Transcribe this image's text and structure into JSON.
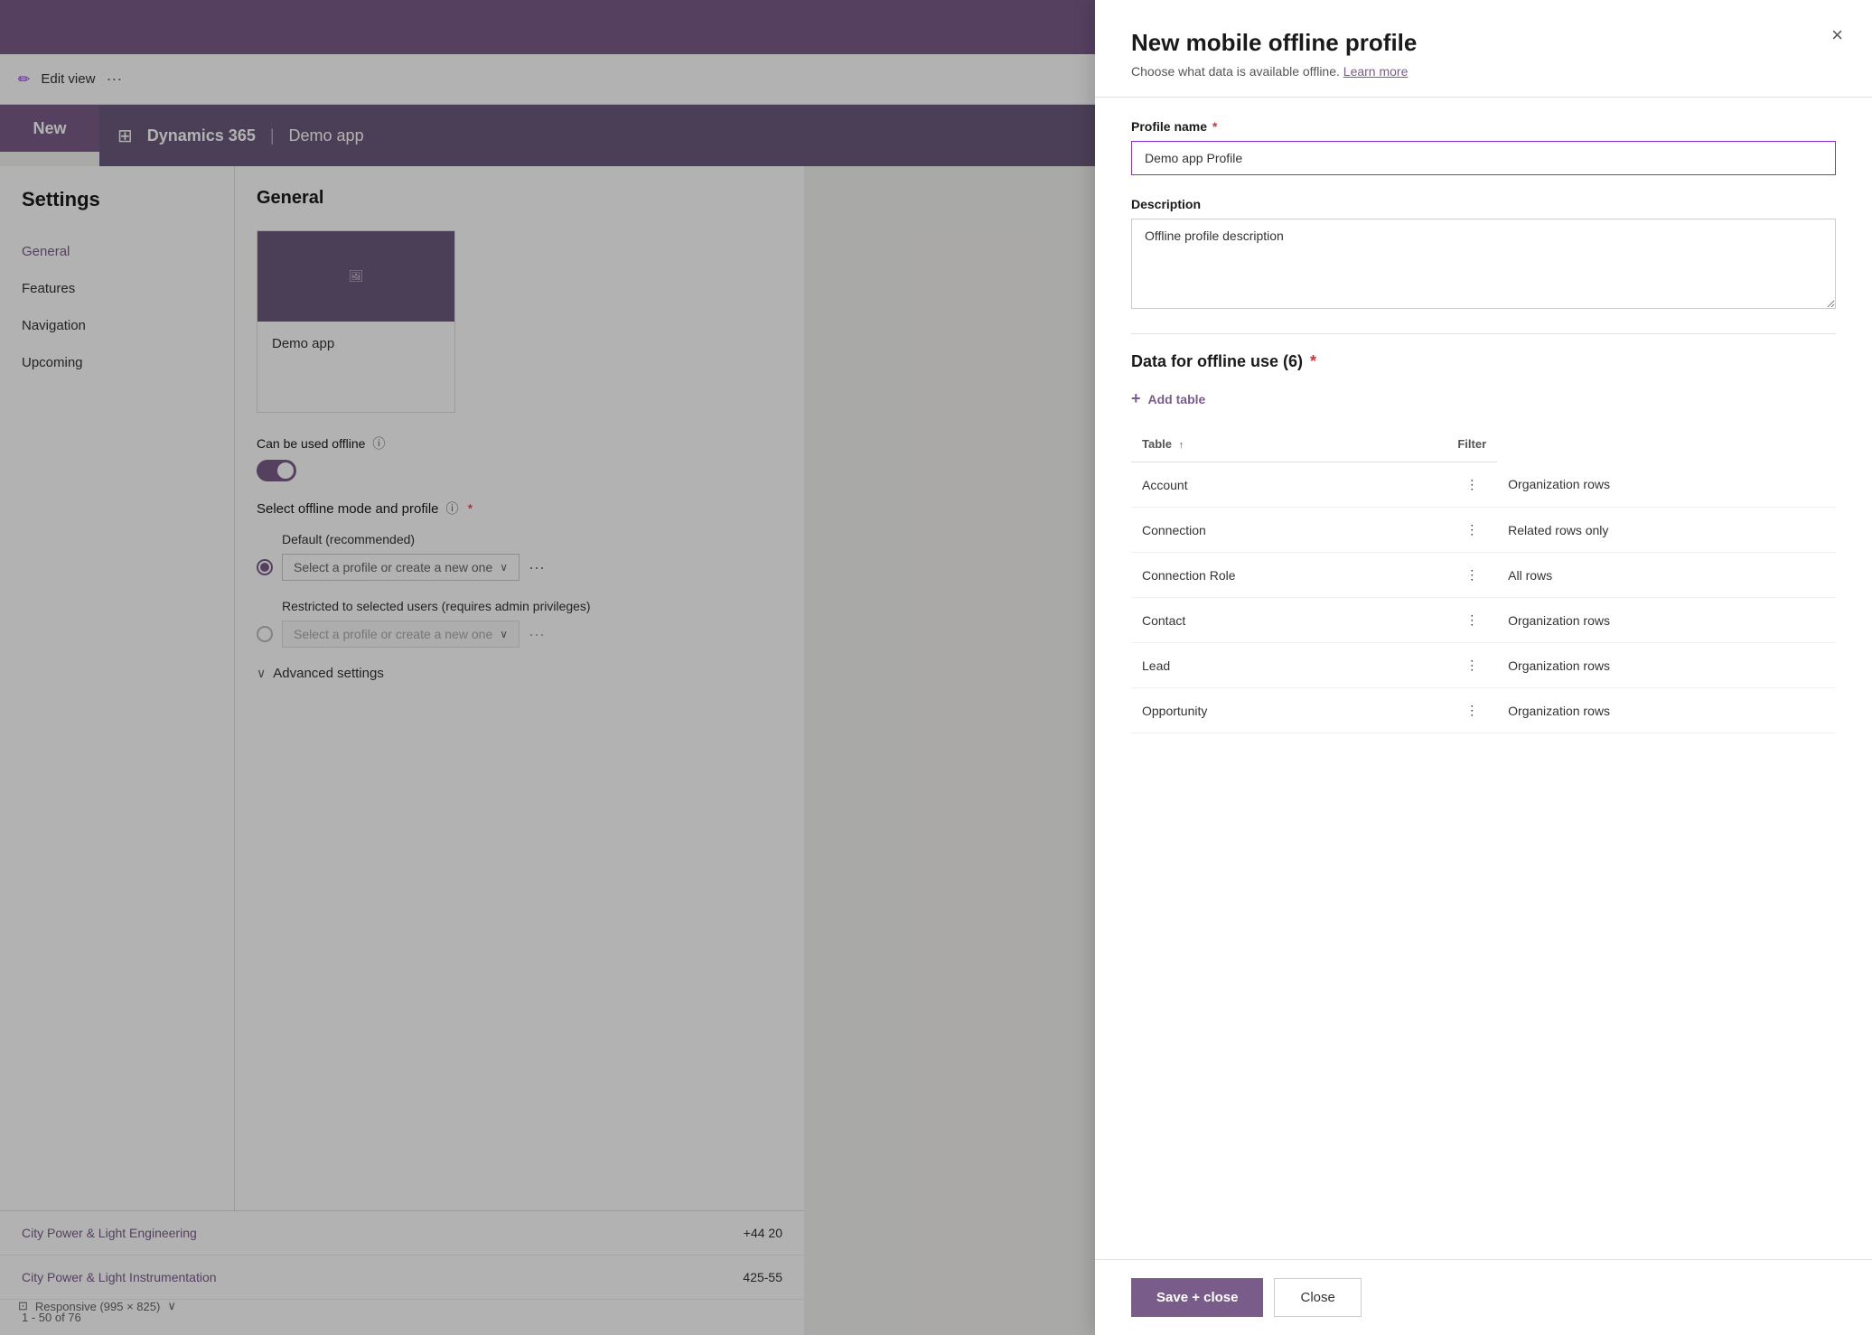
{
  "app": {
    "top_bar": {
      "background": "#7a5c8a"
    },
    "edit_view": {
      "icon": "✏",
      "label": "Edit view",
      "more_label": "···"
    },
    "new_button": {
      "label": "New"
    },
    "dynamics_nav": {
      "grid_icon": "⊞",
      "title": "Dynamics 365",
      "separator": "|",
      "demo_app": "Demo app"
    }
  },
  "settings": {
    "title": "Settings",
    "sidebar": {
      "items": [
        {
          "id": "general",
          "label": "General",
          "active": true
        },
        {
          "id": "features",
          "label": "Features",
          "active": false
        },
        {
          "id": "navigation",
          "label": "Navigation",
          "active": false
        },
        {
          "id": "upcoming",
          "label": "Upcoming",
          "active": false
        }
      ]
    },
    "general": {
      "title": "General",
      "app_name": "Demo app",
      "offline_label": "Can be used offline",
      "info_icon": "ⓘ",
      "select_mode_label": "Select offline mode and profile",
      "required_star": "*",
      "default_option": {
        "label": "Default (recommended)",
        "placeholder": "Select a profile or create a new one",
        "selected": true
      },
      "restricted_option": {
        "label": "Restricted to selected users (requires admin privileges)",
        "placeholder": "Select a profile or create a new one",
        "selected": false
      },
      "advanced_settings": "Advanced settings",
      "more_dots": "···"
    }
  },
  "data_rows": {
    "items": [
      {
        "name": "City Power & Light Engineering",
        "value": "+44 20"
      },
      {
        "name": "City Power & Light Instrumentation",
        "value": "425-55"
      }
    ],
    "pagination": "1 - 50 of 76",
    "responsive_label": "Responsive (995 × 825)"
  },
  "modal": {
    "title": "New mobile offline profile",
    "subtitle": "Choose what data is available offline.",
    "learn_more": "Learn more",
    "close_icon": "×",
    "profile_name_label": "Profile name",
    "profile_name_required": "*",
    "profile_name_value": "Demo app Profile",
    "description_label": "Description",
    "description_value": "Offline profile description",
    "offline_data_title": "Data for offline use (6)",
    "offline_data_required": "*",
    "add_table_label": "Add table",
    "plus_icon": "+",
    "table": {
      "headers": [
        {
          "id": "table",
          "label": "Table",
          "sortable": true,
          "sort_icon": "↑"
        },
        {
          "id": "filter",
          "label": "Filter",
          "sortable": false
        }
      ],
      "rows": [
        {
          "table": "Account",
          "filter": "Organization rows"
        },
        {
          "table": "Connection",
          "filter": "Related rows only"
        },
        {
          "table": "Connection Role",
          "filter": "All rows"
        },
        {
          "table": "Contact",
          "filter": "Organization rows"
        },
        {
          "table": "Lead",
          "filter": "Organization rows"
        },
        {
          "table": "Opportunity",
          "filter": "Organization rows"
        }
      ],
      "more_icon": "⋮"
    },
    "footer": {
      "save_close_label": "Save + close",
      "close_label": "Close"
    }
  }
}
